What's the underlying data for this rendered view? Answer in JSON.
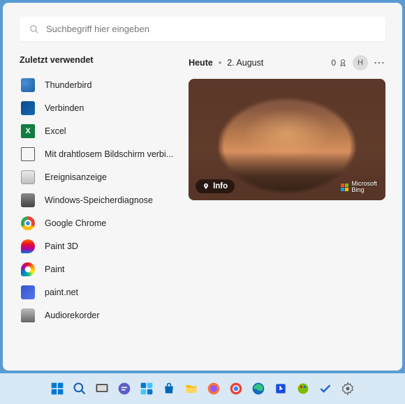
{
  "search": {
    "placeholder": "Suchbegriff hier eingeben"
  },
  "recent": {
    "title": "Zuletzt verwendet",
    "items": [
      {
        "label": "Thunderbird",
        "icon": "thunderbird"
      },
      {
        "label": "Verbinden",
        "icon": "verbinden"
      },
      {
        "label": "Excel",
        "icon": "excel"
      },
      {
        "label": "Mit drahtlosem Bildschirm verbi...",
        "icon": "drahtlos"
      },
      {
        "label": "Ereignisanzeige",
        "icon": "ereignis"
      },
      {
        "label": "Windows-Speicherdiagnose",
        "icon": "speicher"
      },
      {
        "label": "Google Chrome",
        "icon": "chrome"
      },
      {
        "label": "Paint 3D",
        "icon": "paint3d"
      },
      {
        "label": "Paint",
        "icon": "paint"
      },
      {
        "label": "paint.net",
        "icon": "paintnet"
      },
      {
        "label": "Audiorekorder",
        "icon": "audio"
      }
    ]
  },
  "today": {
    "label": "Heute",
    "date": "2. August",
    "points": "0",
    "avatar": "H",
    "info": "Info",
    "bing": "Microsoft\nBing"
  },
  "taskbar": {
    "items": [
      "start",
      "search",
      "taskview",
      "chat",
      "widgets",
      "store",
      "explorer",
      "firefox",
      "chrome",
      "edge",
      "bing",
      "paint",
      "todo",
      "settings"
    ]
  }
}
